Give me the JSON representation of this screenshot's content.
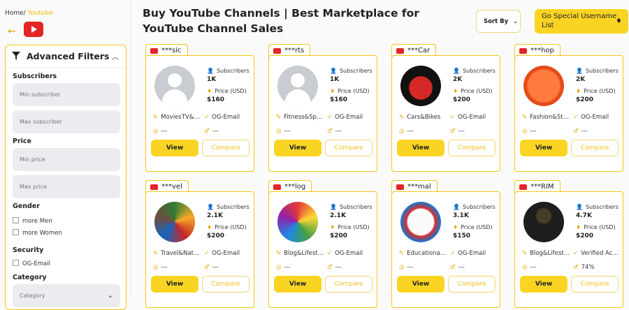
{
  "breadcrumb": {
    "home": "Home",
    "sep": "/",
    "current": "Youtube"
  },
  "filters": {
    "title": "Advanced Filters",
    "subscribers_label": "Subscribers",
    "min_sub": "Min subscriber",
    "max_sub": "Max subscriber",
    "price_label": "Price",
    "min_price": "Min price",
    "max_price": "Max price",
    "gender_label": "Gender",
    "gender_men": "more Men",
    "gender_women": "more Women",
    "security_label": "Security",
    "security_og": "OG-Email",
    "category_label": "Category",
    "category_placeholder": "Category"
  },
  "header": {
    "title": "Buy YouTube Channels | Best Marketplace for YouTube Channel Sales",
    "sort_label": "Sort By",
    "special_label": "Go Special Username List"
  },
  "labels": {
    "subscribers": "Subscribers",
    "price": "Price (USD)",
    "view": "View",
    "compare": "Compare"
  },
  "cards": [
    {
      "name": "***sic",
      "subs": "1K",
      "price": "$160",
      "category": "MoviesTV&…",
      "security": "OG-Email",
      "gender": "---",
      "age": "---",
      "avatar": "default"
    },
    {
      "name": "***rts",
      "subs": "1K",
      "price": "$160",
      "category": "Fitness&Sp…",
      "security": "OG-Email",
      "gender": "---",
      "age": "---",
      "avatar": "default"
    },
    {
      "name": "***Car",
      "subs": "2K",
      "price": "$200",
      "category": "Cars&Bikes",
      "security": "OG-Email",
      "gender": "---",
      "age": "---",
      "avatar": "cars"
    },
    {
      "name": "***hop",
      "subs": "2K",
      "price": "$200",
      "category": "Fashion&St…",
      "security": "OG-Email",
      "gender": "---",
      "age": "---",
      "avatar": "fashion"
    },
    {
      "name": "***vel",
      "subs": "2.1K",
      "price": "$200",
      "category": "Travel&Nat…",
      "security": "OG-Email",
      "gender": "---",
      "age": "---",
      "avatar": "travel"
    },
    {
      "name": "***log",
      "subs": "2.1K",
      "price": "$200",
      "category": "Blog&Lifest…",
      "security": "OG-Email",
      "gender": "---",
      "age": "---",
      "avatar": "vlog"
    },
    {
      "name": "***mal",
      "subs": "3.1K",
      "price": "$150",
      "category": "Educationa…",
      "security": "OG-Email",
      "gender": "---",
      "age": "---",
      "avatar": "english"
    },
    {
      "name": "***RIM",
      "subs": "4.7K",
      "price": "$200",
      "category": "Blog&Lifest…",
      "security": "Verified Ac…",
      "gender": "---",
      "age": "74%",
      "avatar": "person"
    }
  ]
}
